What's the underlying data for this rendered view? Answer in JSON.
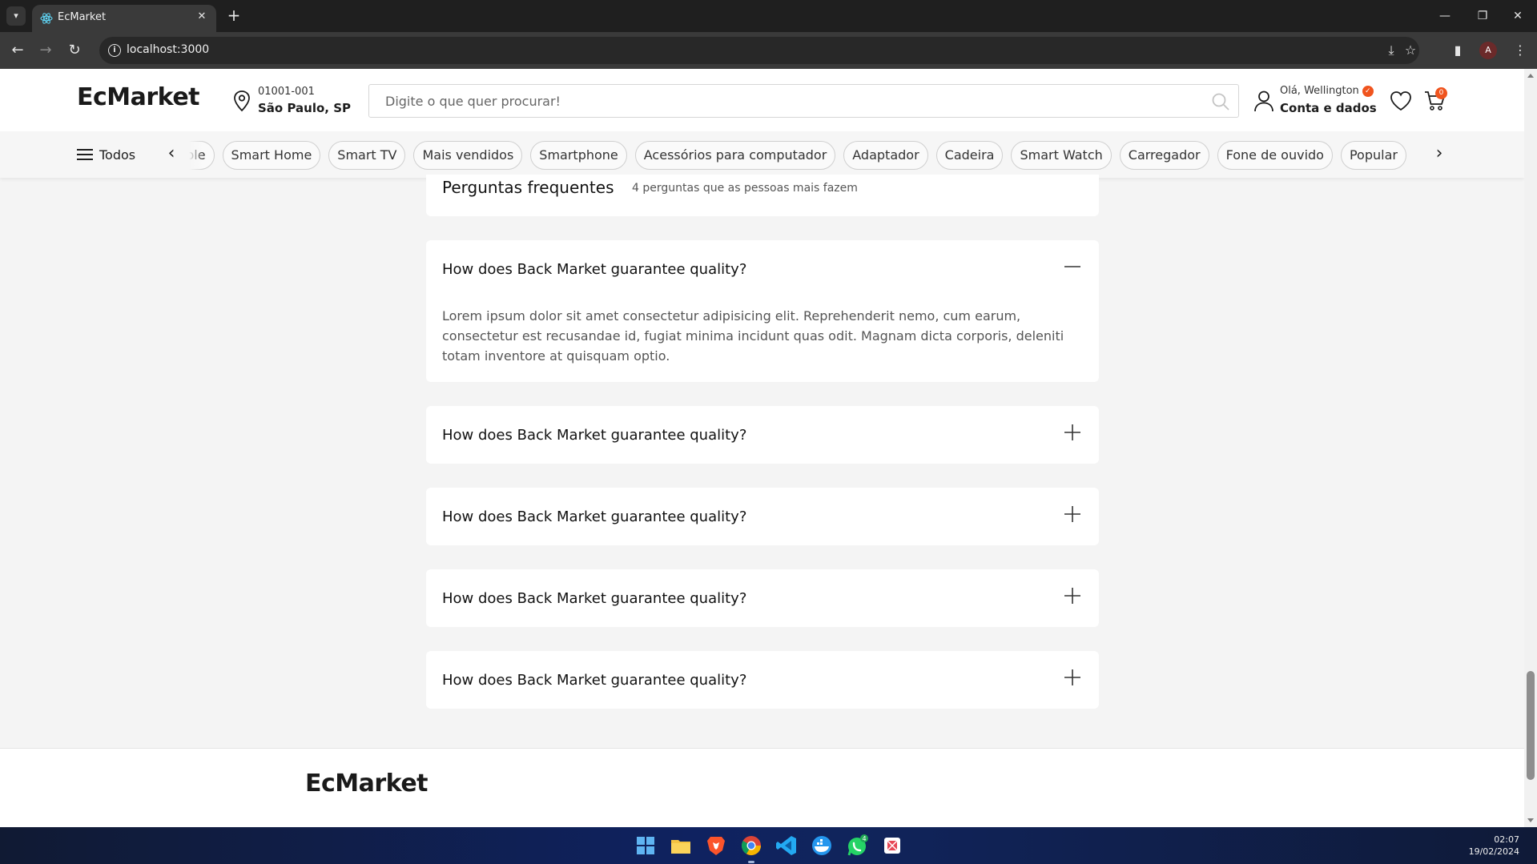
{
  "browser": {
    "tab_title": "EcMarket",
    "url": "localhost:3000",
    "profile_initial": "A"
  },
  "header": {
    "logo": "EcMarket",
    "location": {
      "cep": "01001-001",
      "city": "São Paulo, SP"
    },
    "search": {
      "placeholder": "Digite o que quer procurar!",
      "value": ""
    },
    "account": {
      "greeting": "Olá, Wellington",
      "label": "Conta e dados"
    },
    "cart_count": "0"
  },
  "category_bar": {
    "menu_label": "Todos",
    "chips": [
      "Apple",
      "Smart Home",
      "Smart TV",
      "Mais vendidos",
      "Smartphone",
      "Acessórios para computador",
      "Adaptador",
      "Cadeira",
      "Smart Watch",
      "Carregador",
      "Fone de ouvido",
      "Popular"
    ]
  },
  "faq": {
    "title": "Perguntas frequentes",
    "subtitle": "4 perguntas que as pessoas mais fazem",
    "items": [
      {
        "question": "How does Back Market guarantee quality?",
        "answer": "Lorem ipsum dolor sit amet consectetur adipisicing elit. Reprehenderit nemo, cum earum, consectetur est recusandae id, fugiat minima incidunt quas odit. Magnam dicta corporis, deleniti totam inventore at quisquam optio.",
        "expanded": true
      },
      {
        "question": "How does Back Market guarantee quality?",
        "expanded": false
      },
      {
        "question": "How does Back Market guarantee quality?",
        "expanded": false
      },
      {
        "question": "How does Back Market guarantee quality?",
        "expanded": false
      },
      {
        "question": "How does Back Market guarantee quality?",
        "expanded": false
      }
    ]
  },
  "footer": {
    "logo": "EcMarket"
  },
  "taskbar": {
    "time": "02:07",
    "date": "19/02/2024",
    "whatsapp_badge": "4"
  },
  "colors": {
    "accent": "#f0541e",
    "page_bg": "#f4f4f4",
    "card_bg": "#ffffff",
    "chrome_dark": "#1f1f1f"
  }
}
